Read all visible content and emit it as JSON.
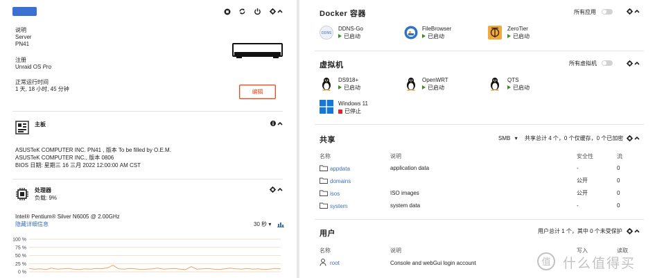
{
  "server": {
    "desc_label": "说明",
    "desc_value_1": "Server",
    "desc_value_2": "PN41",
    "reg_label": "注册",
    "reg_value_prefix": "Unraid OS",
    "reg_value_suffix": "Pro",
    "uptime_label": "正常运行时间",
    "uptime_value": "1 天, 18 小时, 45 分钟",
    "edit_label": "编辑",
    "accent": "#3b6fd0"
  },
  "motherboard": {
    "title": "主板",
    "line1": "ASUSTeK COMPUTER INC. PN41 , 版本 To be filled by O.E.M.",
    "line2": "ASUSTeK COMPUTER INC., 版本 0806",
    "line3": "BIOS 日期: 星期三 16 三月 2022 12:00:00 AM CST"
  },
  "cpu": {
    "title": "处理器",
    "load": "负载: 9%",
    "model": "Intel® Pentium® Silver N6005 @ 2.00GHz",
    "hide_details": "隐藏详细信息",
    "interval": "30 秒",
    "interval_arrow": "▾",
    "y_ticks": [
      "100 %",
      "75 %",
      "50 %",
      "25 %",
      "0 %"
    ]
  },
  "chart_data": {
    "type": "line",
    "title": "",
    "xlabel": "",
    "ylabel": "",
    "ylim": [
      0,
      100
    ],
    "y_tick_labels": [
      "100 %",
      "75 %",
      "50 %",
      "25 %",
      "0 %"
    ],
    "series": [
      {
        "values": [
          10,
          8,
          9,
          7,
          11,
          8,
          9,
          10,
          8,
          7,
          9,
          8,
          10,
          9,
          12,
          20,
          9,
          8,
          10,
          9,
          7,
          8,
          9,
          11,
          8,
          9,
          10,
          8,
          7,
          16,
          8,
          9,
          10,
          8,
          7,
          9,
          11,
          9,
          8,
          10,
          8,
          9,
          7,
          8,
          10,
          9
        ]
      }
    ],
    "grid": true,
    "colors": {
      "line": "#f0a060",
      "grid": "#f2d3b8"
    }
  },
  "docker": {
    "title": "Docker 容器",
    "all_apps": "所有应用",
    "apps": [
      {
        "name": "DDNS-Go",
        "status": "已启动",
        "icon": "ddns-icon"
      },
      {
        "name": "FileBrowser",
        "status": "已启动",
        "icon": "filebrowser-icon"
      },
      {
        "name": "ZeroTier",
        "status": "已启动",
        "icon": "zerotier-icon"
      }
    ]
  },
  "vms": {
    "title": "虚拟机",
    "all_vms": "所有虚拟机",
    "items": [
      {
        "name": "DS918+",
        "status": "已启动",
        "icon": "linux-penguin-icon"
      },
      {
        "name": "OpenWRT",
        "status": "已启动",
        "icon": "linux-penguin-icon"
      },
      {
        "name": "QTS",
        "status": "已启动",
        "icon": "linux-penguin-icon"
      },
      {
        "name": "Windows 11",
        "status": "已停止",
        "icon": "windows-icon"
      }
    ]
  },
  "shares": {
    "title": "共享",
    "filter": "SMB",
    "filter_arrow": "▾",
    "summary": "共享总计 4 个，0 个仅缓存，0 个已加密",
    "col_name": "名称",
    "col_desc": "说明",
    "col_security": "安全性",
    "col_stream": "流",
    "rows": [
      {
        "name": "appdata",
        "desc": "application data",
        "security": "-",
        "stream": "0"
      },
      {
        "name": "domains",
        "desc": "",
        "security": "公开",
        "stream": "0"
      },
      {
        "name": "isos",
        "desc": "ISO images",
        "security": "公开",
        "stream": "0"
      },
      {
        "name": "system",
        "desc": "system data",
        "security": "-",
        "stream": "0"
      }
    ]
  },
  "users": {
    "title": "用户",
    "summary": "用户总计 1 个，其中 0 个未受保护",
    "col_name": "名称",
    "col_desc": "说明",
    "col_write": "写入",
    "col_read": "读取",
    "rows": [
      {
        "name": "root",
        "desc": "Console and webGui login account"
      }
    ]
  },
  "watermark": {
    "text": "什么值得买"
  }
}
